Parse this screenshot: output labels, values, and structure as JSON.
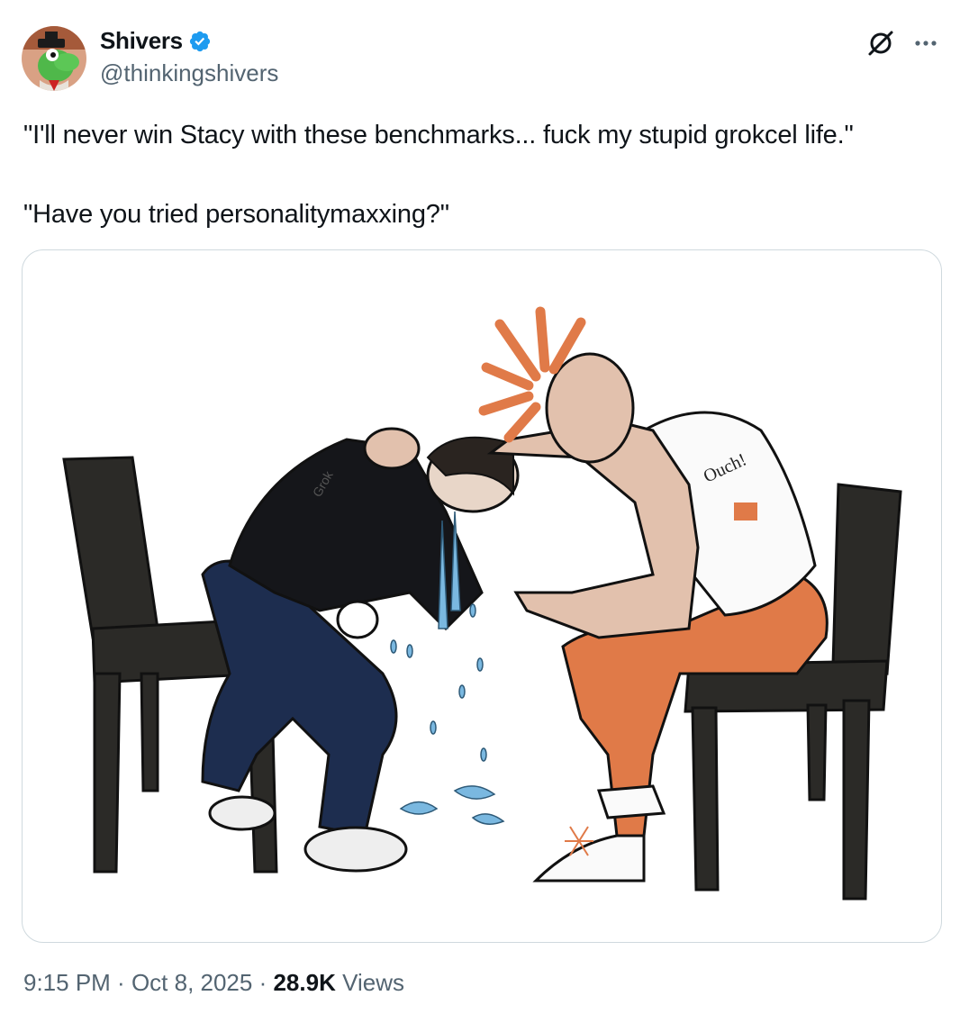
{
  "author": {
    "display_name": "Shivers",
    "handle": "@thinkingshivers",
    "verified": true,
    "avatar_icon": "green-dinosaur-avatar"
  },
  "actions": {
    "grok_icon": "grok-slash-circle-icon",
    "more_icon": "more-dots-icon"
  },
  "tweet": {
    "text": "\"I'll never win Stacy with these benchmarks... fuck my stupid grokcel life.\"\n\n\"Have you tried personalitymaxxing?\""
  },
  "media": {
    "shirt_label_left": "Grok",
    "shirt_label_right": "Ouch!",
    "colors": {
      "chair": "#2b2a27",
      "orange": "#e07a48",
      "skin": "#e2c1ad",
      "jeans": "#1d2d4f",
      "tears": "#7ab8e0"
    }
  },
  "meta": {
    "time": "9:15 PM",
    "sep1": " · ",
    "date": "Oct 8, 2025",
    "sep2": " · ",
    "views_count": "28.9K",
    "views_label": " Views"
  },
  "colors": {
    "verified": "#1d9bf0",
    "muted": "#536471",
    "border": "#cfd9de"
  }
}
